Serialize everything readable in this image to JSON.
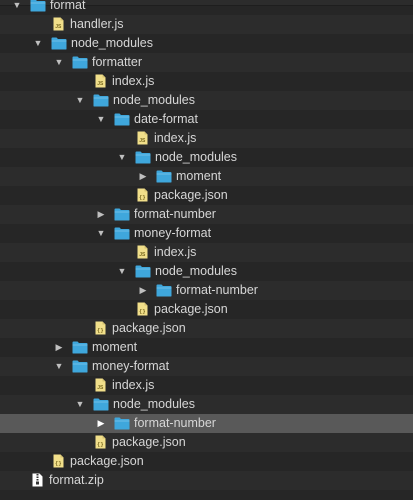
{
  "tree": [
    {
      "depth": 0,
      "type": "folder",
      "arrow": "down",
      "label": "format"
    },
    {
      "depth": 1,
      "type": "js",
      "arrow": "none",
      "label": "handler.js"
    },
    {
      "depth": 1,
      "type": "folder",
      "arrow": "down",
      "label": "node_modules"
    },
    {
      "depth": 2,
      "type": "folder",
      "arrow": "down",
      "label": "formatter"
    },
    {
      "depth": 3,
      "type": "js",
      "arrow": "none",
      "label": "index.js"
    },
    {
      "depth": 3,
      "type": "folder",
      "arrow": "down",
      "label": "node_modules"
    },
    {
      "depth": 4,
      "type": "folder",
      "arrow": "down",
      "label": "date-format"
    },
    {
      "depth": 5,
      "type": "js",
      "arrow": "none",
      "label": "index.js"
    },
    {
      "depth": 5,
      "type": "folder",
      "arrow": "down",
      "label": "node_modules"
    },
    {
      "depth": 6,
      "type": "folder",
      "arrow": "right",
      "label": "moment"
    },
    {
      "depth": 5,
      "type": "json",
      "arrow": "none",
      "label": "package.json"
    },
    {
      "depth": 4,
      "type": "folder",
      "arrow": "right",
      "label": "format-number"
    },
    {
      "depth": 4,
      "type": "folder",
      "arrow": "down",
      "label": "money-format"
    },
    {
      "depth": 5,
      "type": "js",
      "arrow": "none",
      "label": "index.js"
    },
    {
      "depth": 5,
      "type": "folder",
      "arrow": "down",
      "label": "node_modules"
    },
    {
      "depth": 6,
      "type": "folder",
      "arrow": "right",
      "label": "format-number"
    },
    {
      "depth": 5,
      "type": "json",
      "arrow": "none",
      "label": "package.json"
    },
    {
      "depth": 3,
      "type": "json",
      "arrow": "none",
      "label": "package.json"
    },
    {
      "depth": 2,
      "type": "folder",
      "arrow": "right",
      "label": "moment"
    },
    {
      "depth": 2,
      "type": "folder",
      "arrow": "down",
      "label": "money-format"
    },
    {
      "depth": 3,
      "type": "js",
      "arrow": "none",
      "label": "index.js"
    },
    {
      "depth": 3,
      "type": "folder",
      "arrow": "down",
      "label": "node_modules"
    },
    {
      "depth": 4,
      "type": "folder",
      "arrow": "right",
      "label": "format-number",
      "selected": true
    },
    {
      "depth": 3,
      "type": "json",
      "arrow": "none",
      "label": "package.json"
    },
    {
      "depth": 1,
      "type": "json",
      "arrow": "none",
      "label": "package.json"
    },
    {
      "depth": 0,
      "type": "zip",
      "arrow": "none",
      "label": "format.zip"
    }
  ],
  "colors": {
    "background": "#262626",
    "row_alt": "#2c2c2c",
    "selected": "#595959",
    "folder": "#3fa7dc",
    "file_js": "#f1df8a",
    "file_json": "#f1df8a",
    "file_zip": "#ffffff",
    "text": "#d6d6d6"
  }
}
